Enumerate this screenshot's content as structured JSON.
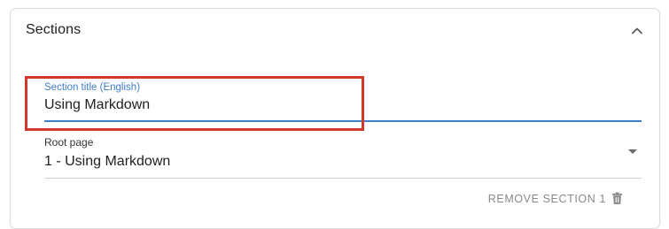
{
  "sections": {
    "title": "Sections",
    "collapse_icon": "chevron-up-icon",
    "section_title_field": {
      "label": "Section title (English)",
      "value": "Using Markdown",
      "accent_color": "#3f7ec9"
    },
    "root_page_field": {
      "label": "Root page",
      "value": "1 - Using Markdown",
      "dropdown_icon": "caret-down-icon"
    },
    "remove_button": {
      "label": "REMOVE SECTION 1",
      "icon": "trash-icon"
    },
    "highlight_color": "#d2392b"
  }
}
